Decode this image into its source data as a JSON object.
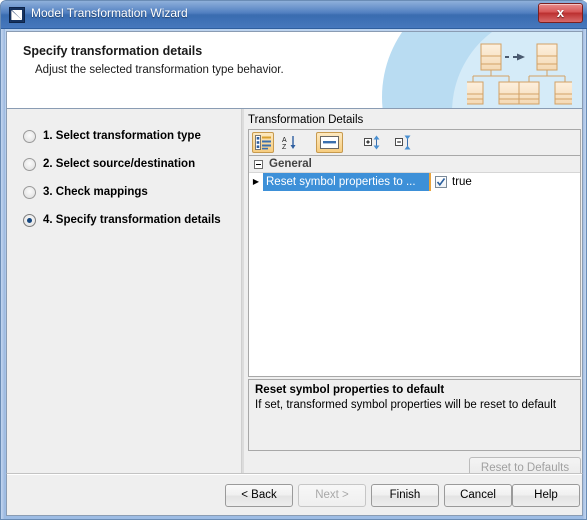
{
  "window": {
    "title": "Model Transformation Wizard",
    "app_icon": "app-logo-icon",
    "close_label": "x"
  },
  "header": {
    "title": "Specify transformation details",
    "subtitle": "Adjust the selected transformation type behavior.",
    "graphic": "model-transformation-diagram-icon"
  },
  "steps": [
    {
      "label": "1. Select transformation type",
      "selected": false
    },
    {
      "label": "2. Select source/destination",
      "selected": false
    },
    {
      "label": "3. Check mappings",
      "selected": false
    },
    {
      "label": "4. Specify transformation details",
      "selected": true
    }
  ],
  "detail": {
    "panel_title": "Transformation Details",
    "toolbar": [
      {
        "name": "categorized-view-icon",
        "active": true
      },
      {
        "name": "alphabetic-sort-icon",
        "active": false
      },
      {
        "name": "show-description-icon",
        "active": true
      },
      {
        "name": "expand-all-icon",
        "active": false
      },
      {
        "name": "collapse-all-icon",
        "active": false
      }
    ],
    "group": {
      "label": "General",
      "expanded": true
    },
    "properties": [
      {
        "name": "Reset symbol properties to ...",
        "value": "true",
        "checked": true,
        "selected": true
      }
    ],
    "description": {
      "title": "Reset symbol properties to default",
      "text": "If set, transformed symbol properties will be reset to default"
    },
    "reset_button": {
      "label": "Reset to Defaults",
      "enabled": false
    }
  },
  "footer": {
    "buttons": [
      {
        "label": "< Back",
        "enabled": true
      },
      {
        "label": "Next >",
        "enabled": false
      },
      {
        "label": "Finish",
        "enabled": true
      },
      {
        "label": "Cancel",
        "enabled": true
      },
      {
        "label": "Help",
        "enabled": true
      }
    ]
  },
  "colors": {
    "titlebar": "#3f72ba",
    "selection": "#3d90d8",
    "selection_marker": "#e8a33d",
    "toolbar_active": "#f7cd7f",
    "accent_light": "#b9dcf2",
    "close_button": "#bb2f2f"
  }
}
